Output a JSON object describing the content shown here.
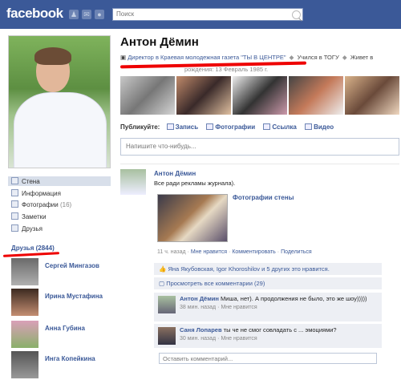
{
  "header": {
    "logo": "facebook",
    "search_placeholder": "Поиск"
  },
  "left_nav": {
    "items": [
      {
        "label": "Стена"
      },
      {
        "label": "Информация"
      },
      {
        "label": "Фотографии",
        "count": "(16)"
      },
      {
        "label": "Заметки"
      },
      {
        "label": "Друзья"
      }
    ]
  },
  "friends": {
    "header": "Друзья (2844)",
    "list": [
      {
        "name": "Сергей Мингазов"
      },
      {
        "name": "Ирина Мустафина"
      },
      {
        "name": "Анна Губина"
      },
      {
        "name": "Инга Копейкина"
      }
    ]
  },
  "profile": {
    "name": "Антон Дёмин",
    "job": "Директор в Краевая молодежная газета \"ТЫ В ЦЕНТРЕ\"",
    "study": "Учился в ТОГУ",
    "lives": "Живет в",
    "birthday": "рождения: 13 Февраль 1985 г."
  },
  "publisher": {
    "label": "Публикуйте:",
    "options": [
      "Запись",
      "Фотографии",
      "Ссылка",
      "Видео"
    ],
    "placeholder": "Напишите что-нибудь..."
  },
  "post": {
    "author": "Антон Дёмин",
    "text": "Все ради рекламы журнала).",
    "album_title": "Фотографии стены",
    "meta_time": "11 ч. назад",
    "meta_like": "Мне нравится",
    "meta_comment": "Комментировать",
    "meta_share": "Поделиться",
    "likes_text": "Яна Якубовская, Igor Khoroshilov и 5 других это нравится.",
    "view_all": "Просмотреть все комментарии (29)"
  },
  "comments": [
    {
      "author": "Антон Дёмин",
      "text": "Миша, нет). А продолжения не было, это же шоу)))))",
      "time": "38 мин. назад",
      "like": "Мне нравится"
    },
    {
      "author": "Саня Лопарев",
      "text": "ты че не смог совладать с ... эмоциями?",
      "time": "30 мин. назад",
      "like": "Мне нравится"
    }
  ],
  "reply_placeholder": "Оставить комментарий..."
}
